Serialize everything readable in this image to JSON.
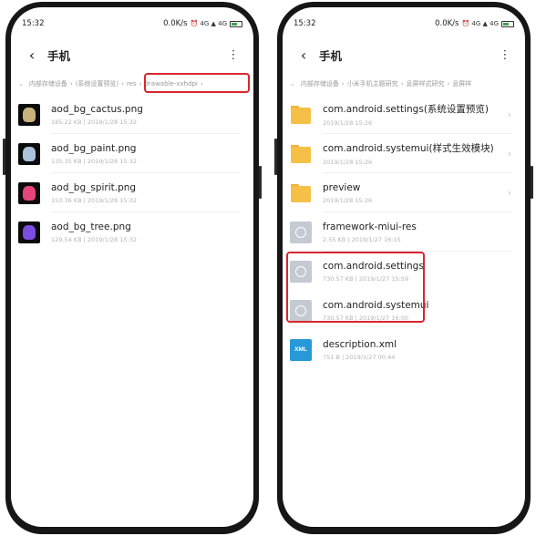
{
  "left_phone": {
    "status": {
      "time": "15:32",
      "speed": "0.0K/s",
      "icons": "⏰ 4G ▲ 4G"
    },
    "title": "手机",
    "back_glyph": "‹",
    "more_glyph": "⋮",
    "breadcrumb": [
      "内部存储设备",
      "(系统设置预览)",
      "res",
      "drawable-xxhdpi"
    ],
    "files": [
      {
        "name": "aod_bg_cactus.png",
        "meta": "185.22 KB  |  2019/1/28 15:32",
        "color": "#c8b27a"
      },
      {
        "name": "aod_bg_paint.png",
        "meta": "135.35 KB  |  2019/1/28 15:32",
        "color": "#a9c2d9"
      },
      {
        "name": "aod_bg_spirit.png",
        "meta": "153.36 KB  |  2019/1/28 15:32",
        "color": "#e6447a"
      },
      {
        "name": "aod_bg_tree.png",
        "meta": "129.54 KB  |  2019/1/28 15:32",
        "color": "#7b4de0"
      }
    ]
  },
  "right_phone": {
    "status": {
      "time": "15:32",
      "speed": "0.0K/s",
      "icons": "⏰ 4G ▲ 4G"
    },
    "title": "手机",
    "back_glyph": "‹",
    "more_glyph": "⋮",
    "breadcrumb": [
      "内部存储设备",
      "小米手机主题研究",
      "息屏样式研究",
      "息屏样"
    ],
    "items": [
      {
        "type": "folder",
        "name": "com.android.settings(系统设置预览)",
        "meta": "2019/1/28 15:26",
        "chevron": "›"
      },
      {
        "type": "folder",
        "name": "com.android.systemui(样式生效模块)",
        "meta": "2019/1/28 15:26",
        "chevron": "›"
      },
      {
        "type": "folder",
        "name": "preview",
        "meta": "2019/1/28 15:26",
        "chevron": "›"
      },
      {
        "type": "file",
        "name": "framework-miui-res",
        "meta": "2.55 KB  |  2019/1/27 16:15",
        "chevron": ""
      },
      {
        "type": "file",
        "name": "com.android.settings",
        "meta": "730.57 KB  |  2019/1/27 15:59",
        "chevron": ""
      },
      {
        "type": "file",
        "name": "com.android.systemui",
        "meta": "730.57 KB  |  2019/1/27 16:00",
        "chevron": ""
      },
      {
        "type": "xml",
        "name": "description.xml",
        "meta": "751 B  |  2019/1/27 00:44",
        "chevron": "",
        "icon_label": "XML"
      }
    ]
  },
  "colors": {
    "highlight": "#d9262e",
    "folder": "#f6c047",
    "xml_icon": "#2798d8"
  }
}
